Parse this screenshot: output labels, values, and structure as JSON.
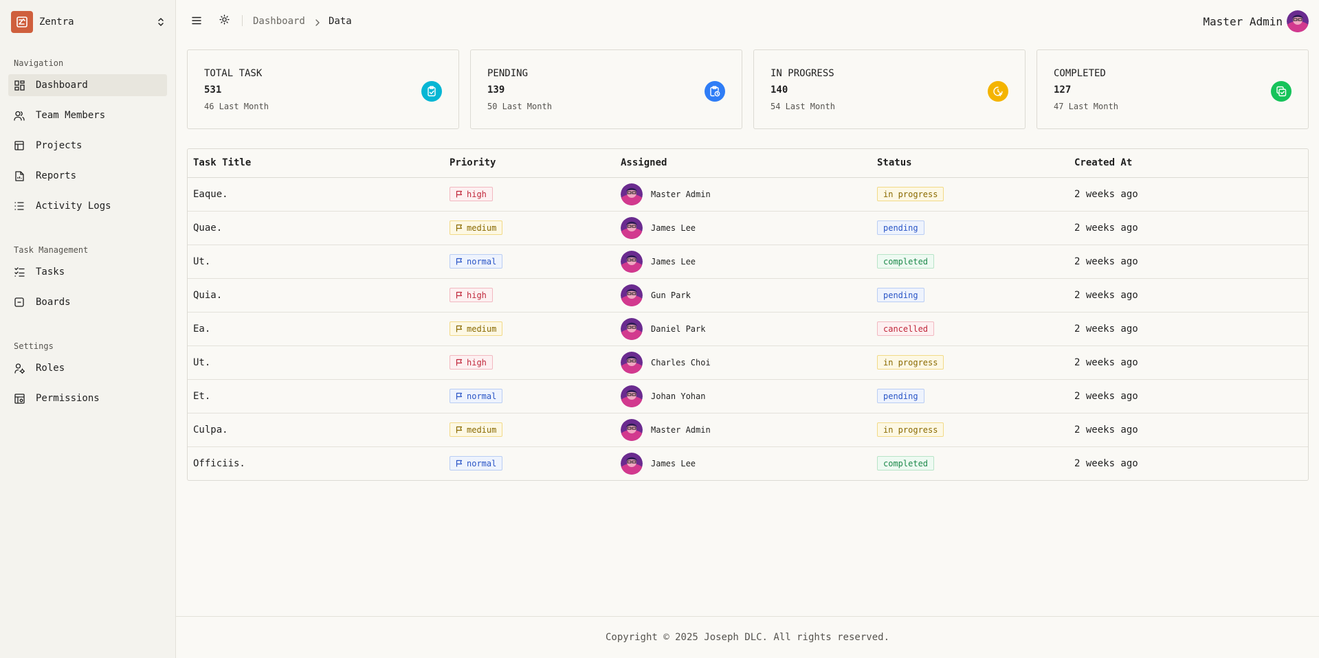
{
  "app": {
    "name": "Zentra",
    "brand_color": "#cf5f3d"
  },
  "sidebar": {
    "groups": [
      {
        "label": "Navigation",
        "items": [
          {
            "label": "Dashboard",
            "icon": "dashboard-icon",
            "active": true
          },
          {
            "label": "Team Members",
            "icon": "users-icon"
          },
          {
            "label": "Projects",
            "icon": "projects-icon"
          },
          {
            "label": "Reports",
            "icon": "reports-icon"
          },
          {
            "label": "Activity Logs",
            "icon": "list-icon"
          }
        ]
      },
      {
        "label": "Task Management",
        "items": [
          {
            "label": "Tasks",
            "icon": "tasks-icon"
          },
          {
            "label": "Boards",
            "icon": "board-icon"
          }
        ]
      },
      {
        "label": "Settings",
        "items": [
          {
            "label": "Roles",
            "icon": "user-cog-icon"
          },
          {
            "label": "Permissions",
            "icon": "permissions-icon"
          }
        ]
      }
    ]
  },
  "header": {
    "breadcrumb": {
      "parent": "Dashboard",
      "current": "Data"
    },
    "user_name": "Master Admin"
  },
  "stats": [
    {
      "title": "TOTAL TASK",
      "value": "531",
      "sub": "46 Last Month",
      "icon": "clipboard-check-icon",
      "color": "#06b6d4"
    },
    {
      "title": "PENDING",
      "value": "139",
      "sub": "50 Last Month",
      "icon": "clipboard-clock-icon",
      "color": "#2f7df6"
    },
    {
      "title": "IN PROGRESS",
      "value": "140",
      "sub": "54 Last Month",
      "icon": "clock-arrow-icon",
      "color": "#f4b400"
    },
    {
      "title": "COMPLETED",
      "value": "127",
      "sub": "47 Last Month",
      "icon": "copy-check-icon",
      "color": "#16c35a"
    }
  ],
  "table": {
    "headers": [
      "Task Title",
      "Priority",
      "Assigned",
      "Status",
      "Created At"
    ],
    "rows": [
      {
        "title": "Eaque.",
        "priority": "high",
        "assigned": "Master Admin",
        "status": "in progress",
        "created": "2 weeks ago"
      },
      {
        "title": "Quae.",
        "priority": "medium",
        "assigned": "James Lee",
        "status": "pending",
        "created": "2 weeks ago"
      },
      {
        "title": "Ut.",
        "priority": "normal",
        "assigned": "James Lee",
        "status": "completed",
        "created": "2 weeks ago"
      },
      {
        "title": "Quia.",
        "priority": "high",
        "assigned": "Gun Park",
        "status": "pending",
        "created": "2 weeks ago"
      },
      {
        "title": "Ea.",
        "priority": "medium",
        "assigned": "Daniel Park",
        "status": "cancelled",
        "created": "2 weeks ago"
      },
      {
        "title": "Ut.",
        "priority": "high",
        "assigned": "Charles Choi",
        "status": "in progress",
        "created": "2 weeks ago"
      },
      {
        "title": "Et.",
        "priority": "normal",
        "assigned": "Johan Yohan",
        "status": "pending",
        "created": "2 weeks ago"
      },
      {
        "title": "Culpa.",
        "priority": "medium",
        "assigned": "Master Admin",
        "status": "in progress",
        "created": "2 weeks ago"
      },
      {
        "title": "Officiis.",
        "priority": "normal",
        "assigned": "James Lee",
        "status": "completed",
        "created": "2 weeks ago"
      }
    ]
  },
  "footer": {
    "text": "Copyright © 2025 Joseph DLC. All rights reserved."
  }
}
